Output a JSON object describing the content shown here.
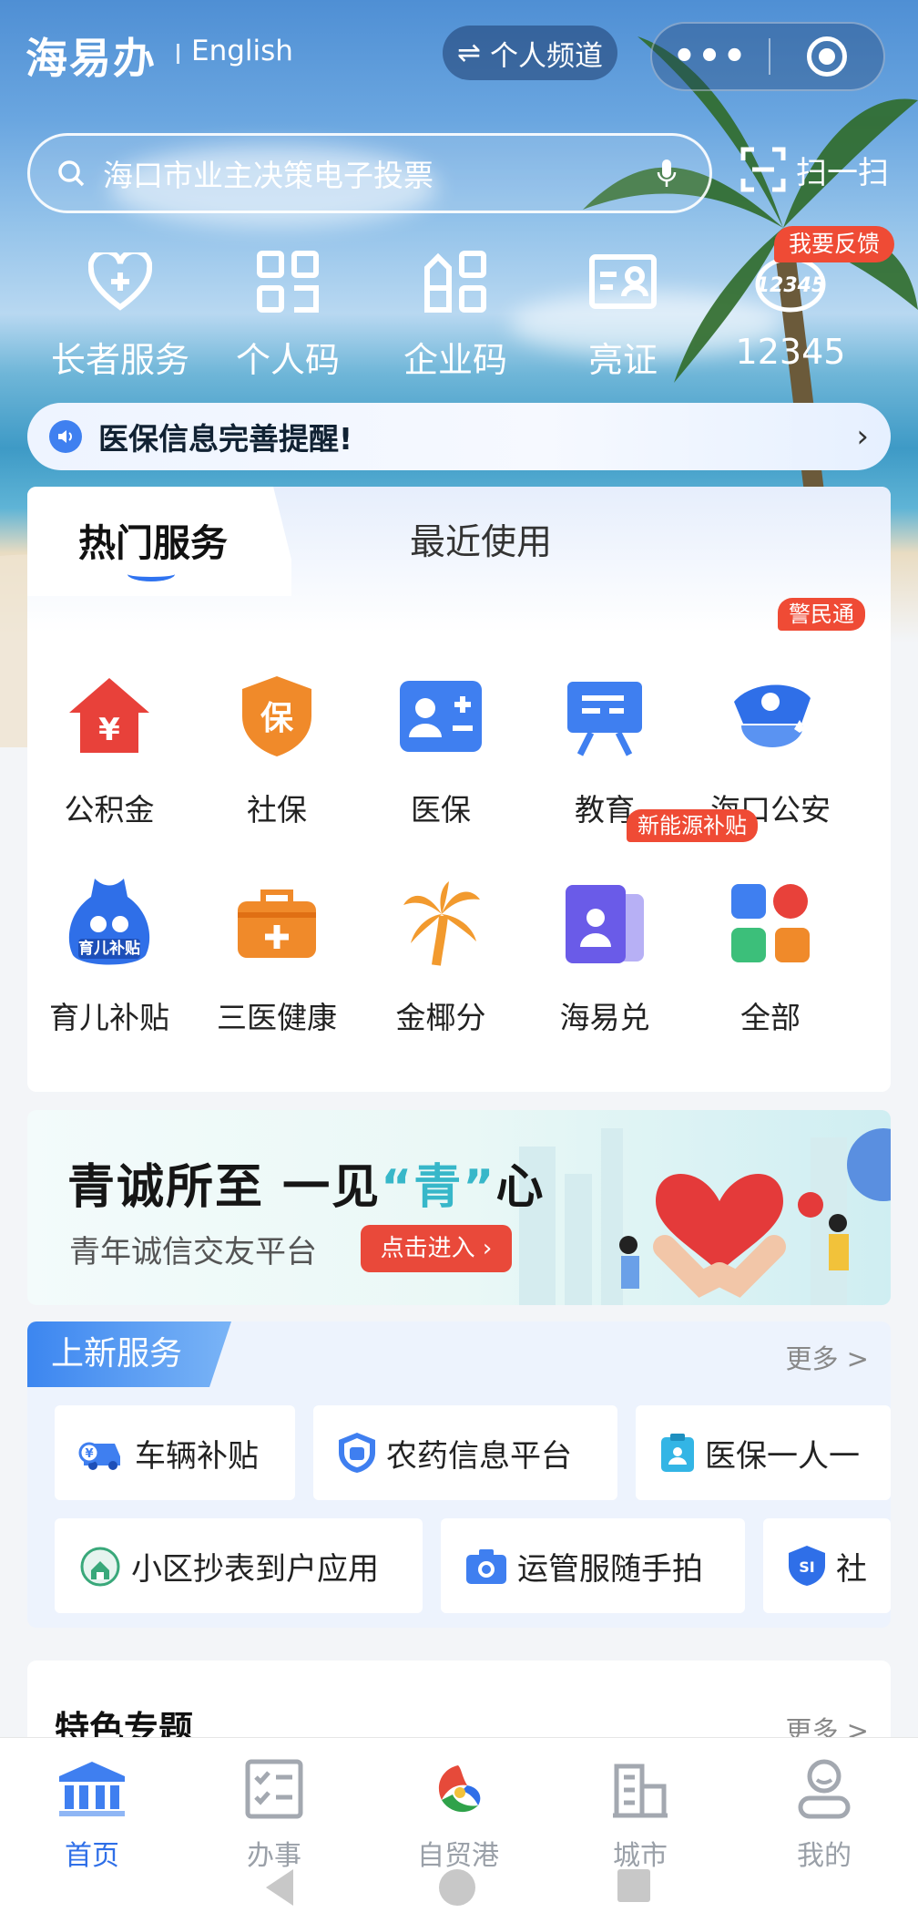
{
  "header": {
    "logo": "海易办",
    "language": "English",
    "personal_channel": "个人频道",
    "more_dots": "•••"
  },
  "search": {
    "placeholder": "海口市业主决策电子投票",
    "scan_label": "扫一扫"
  },
  "quick_services": [
    {
      "label": "长者服务",
      "icon": "heart-plus-icon"
    },
    {
      "label": "个人码",
      "icon": "personal-code-icon"
    },
    {
      "label": "企业码",
      "icon": "enterprise-code-icon"
    },
    {
      "label": "亮证",
      "icon": "id-card-icon"
    },
    {
      "label": "12345",
      "icon": "hotline-12345-icon"
    }
  ],
  "feedback_tag": "我要反馈",
  "notice": {
    "text": "医保信息完善提醒!"
  },
  "service_tabs": {
    "active": "热门服务",
    "other": "最近使用"
  },
  "services": [
    {
      "label": "公积金",
      "icon": "housing-fund-icon",
      "color": "#e8413a"
    },
    {
      "label": "社保",
      "icon": "social-security-icon",
      "color": "#f08a2a"
    },
    {
      "label": "医保",
      "icon": "medical-insurance-icon",
      "color": "#3f7ff0"
    },
    {
      "label": "教育",
      "icon": "education-icon",
      "color": "#3f7ff0"
    },
    {
      "label": "海口公安",
      "icon": "police-icon",
      "color": "#2f6fe8",
      "tag": "警民通"
    },
    {
      "label": "育儿补贴",
      "icon": "childcare-subsidy-icon",
      "color": "#2f6fe8",
      "badge_text": "育儿补贴"
    },
    {
      "label": "三医健康",
      "icon": "medical-kit-icon",
      "color": "#f08a2a"
    },
    {
      "label": "金椰分",
      "icon": "coconut-tree-icon",
      "color": "#f29a2e"
    },
    {
      "label": "海易兑",
      "icon": "member-card-icon",
      "color": "#6a5be8",
      "tag": "新能源补贴"
    },
    {
      "label": "全部",
      "icon": "all-apps-icon",
      "color": "#3f7ff0"
    }
  ],
  "banner": {
    "title_a": "青诚所至 一见",
    "title_q": "“青”",
    "title_b": "心",
    "subtitle": "青年诚信交友平台",
    "button": "点击进入"
  },
  "new_services": {
    "title": "上新服务",
    "more": "更多 >",
    "row1": [
      "车辆补贴",
      "农药信息平台",
      "医保一人一"
    ],
    "row2": [
      "小区抄表到户应用",
      "运管服随手拍",
      "社"
    ]
  },
  "featured": {
    "title": "特色专题",
    "more": "更多 >"
  },
  "bottom_nav": [
    {
      "label": "首页",
      "icon": "home-icon",
      "active": true
    },
    {
      "label": "办事",
      "icon": "tasks-icon"
    },
    {
      "label": "自贸港",
      "icon": "free-trade-port-icon"
    },
    {
      "label": "城市",
      "icon": "city-icon"
    },
    {
      "label": "我的",
      "icon": "profile-icon"
    }
  ]
}
